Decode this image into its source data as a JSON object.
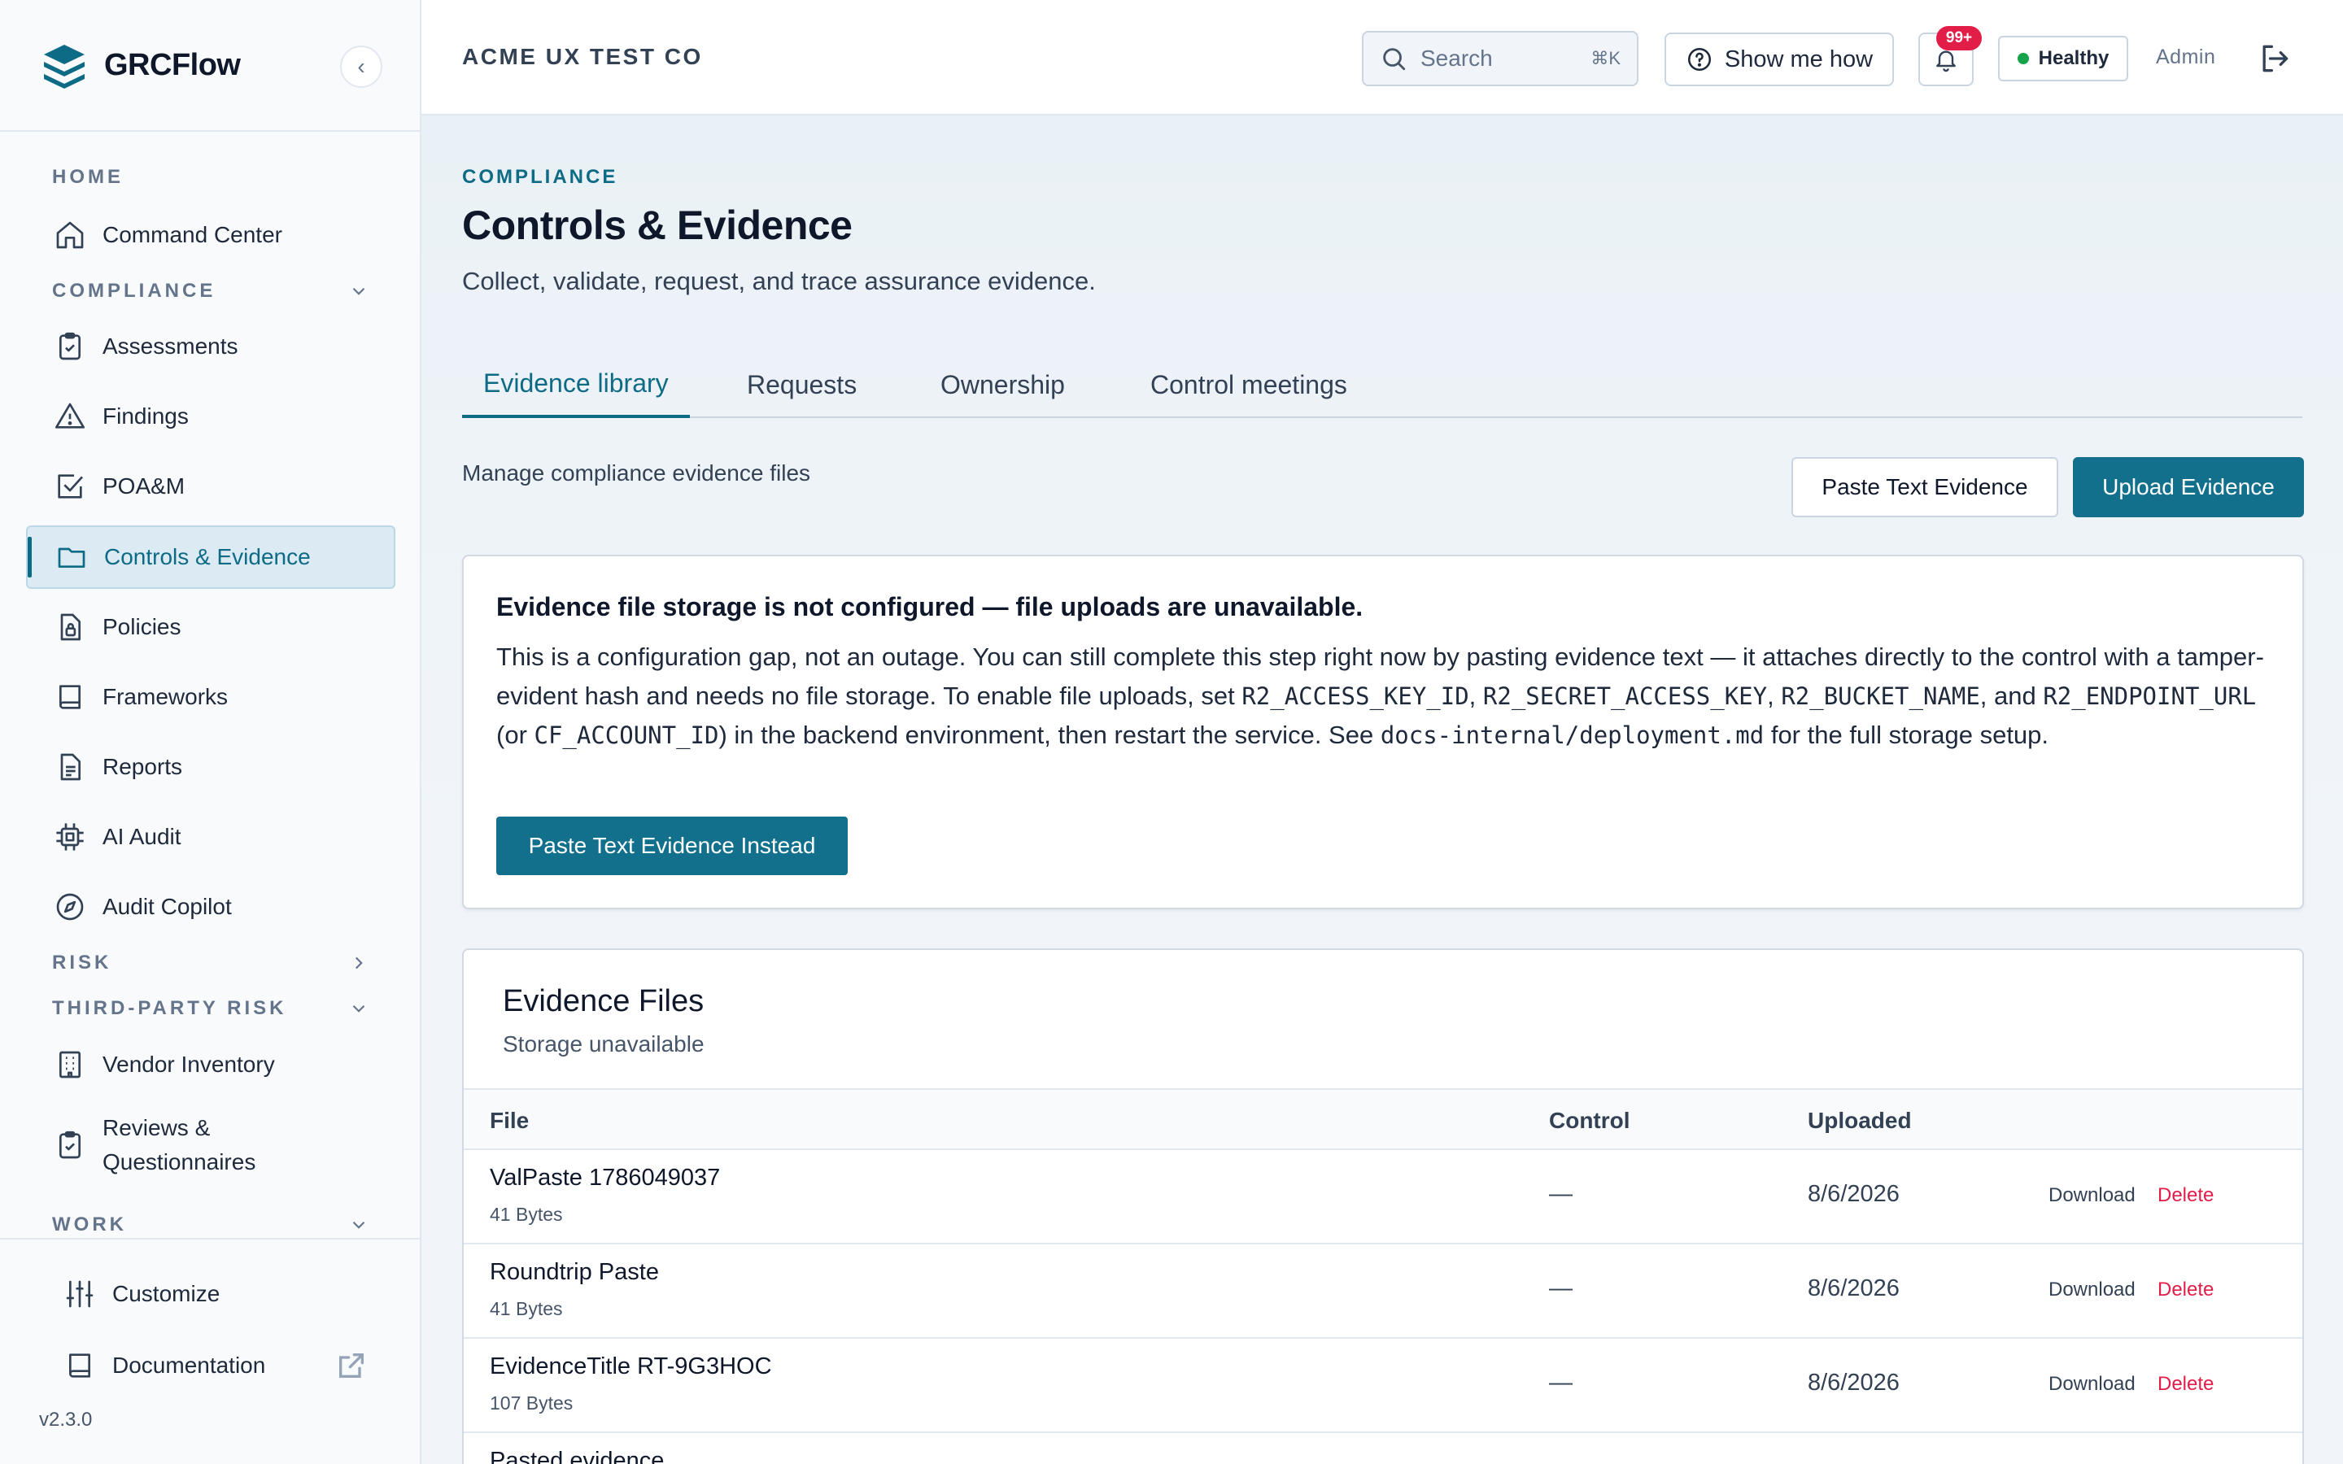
{
  "brand": {
    "name": "GRCFlow",
    "collapse_icon": "‹"
  },
  "sidebar": {
    "sections": [
      {
        "label": "HOME"
      },
      {
        "label": "COMPLIANCE"
      },
      {
        "label": "RISK"
      },
      {
        "label": "THIRD-PARTY RISK"
      },
      {
        "label": "WORK"
      }
    ],
    "items": [
      {
        "label": "Command Center",
        "icon": "home-icon"
      },
      {
        "label": "Assessments",
        "icon": "clipboard-check-icon"
      },
      {
        "label": "Findings",
        "icon": "warning-icon"
      },
      {
        "label": "POA&M",
        "icon": "check-square-icon"
      },
      {
        "label": "Controls & Evidence",
        "icon": "folder-icon",
        "active": true
      },
      {
        "label": "Policies",
        "icon": "file-lock-icon"
      },
      {
        "label": "Frameworks",
        "icon": "book-icon"
      },
      {
        "label": "Reports",
        "icon": "file-text-icon"
      },
      {
        "label": "AI Audit",
        "icon": "cpu-icon"
      },
      {
        "label": "Audit Copilot",
        "icon": "compass-icon"
      },
      {
        "label": "Vendor Inventory",
        "icon": "building-icon"
      },
      {
        "label": "Reviews & Questionnaires",
        "label_line1": "Reviews &",
        "label_line2": "Questionnaires",
        "icon": "clipboard-check-icon"
      }
    ],
    "footer": {
      "customize": "Customize",
      "documentation": "Documentation",
      "version": "v2.3.0"
    }
  },
  "topbar": {
    "org": "ACME UX TEST CO",
    "search_placeholder": "Search",
    "search_shortcut": "⌘K",
    "show_me_how": "Show me how",
    "notifications_badge": "99+",
    "health_status": "Healthy",
    "health_color": "#16a34a",
    "role": "Admin"
  },
  "page": {
    "eyebrow": "COMPLIANCE",
    "title": "Controls & Evidence",
    "subtitle": "Collect, validate, request, and trace assurance evidence.",
    "tabs": [
      "Evidence library",
      "Requests",
      "Ownership",
      "Control meetings"
    ],
    "active_tab": "Evidence library",
    "manage_text": "Manage compliance evidence files",
    "paste_button": "Paste Text Evidence",
    "upload_button": "Upload Evidence",
    "accent_color": "#12708c"
  },
  "alert": {
    "title": "Evidence file storage is not configured — file uploads are unavailable.",
    "body_1": "This is a configuration gap, not an outage. You can still complete this step right now by pasting evidence text — it attaches directly to the control with a tamper-evident hash and needs no file storage. To enable file uploads, set ",
    "code_1": "R2_ACCESS_KEY_ID",
    "sep_1": ", ",
    "code_2": "R2_SECRET_ACCESS_KEY",
    "sep_2": ", ",
    "code_3": "R2_BUCKET_NAME",
    "sep_3": ", and ",
    "code_4": "R2_ENDPOINT_URL",
    "sep_4": " (or ",
    "code_5": "CF_ACCOUNT_ID",
    "sep_5": ") in the backend environment, then restart the service. See ",
    "code_6": "docs-internal/deployment.md",
    "body_end": " for the full storage setup.",
    "button": "Paste Text Evidence Instead"
  },
  "files": {
    "title": "Evidence Files",
    "subtitle": "Storage unavailable",
    "columns": {
      "file": "File",
      "control": "Control",
      "uploaded": "Uploaded"
    },
    "download_label": "Download",
    "delete_label": "Delete",
    "rows": [
      {
        "name": "ValPaste 1786049037",
        "size": "41 Bytes",
        "control": "—",
        "uploaded": "8/6/2026"
      },
      {
        "name": "Roundtrip Paste",
        "size": "41 Bytes",
        "control": "—",
        "uploaded": "8/6/2026"
      },
      {
        "name": "EvidenceTitle RT-9G3HOC",
        "size": "107 Bytes",
        "control": "—",
        "uploaded": "8/6/2026"
      },
      {
        "name": "Pasted evidence",
        "size": "",
        "control": "",
        "uploaded": ""
      }
    ]
  }
}
